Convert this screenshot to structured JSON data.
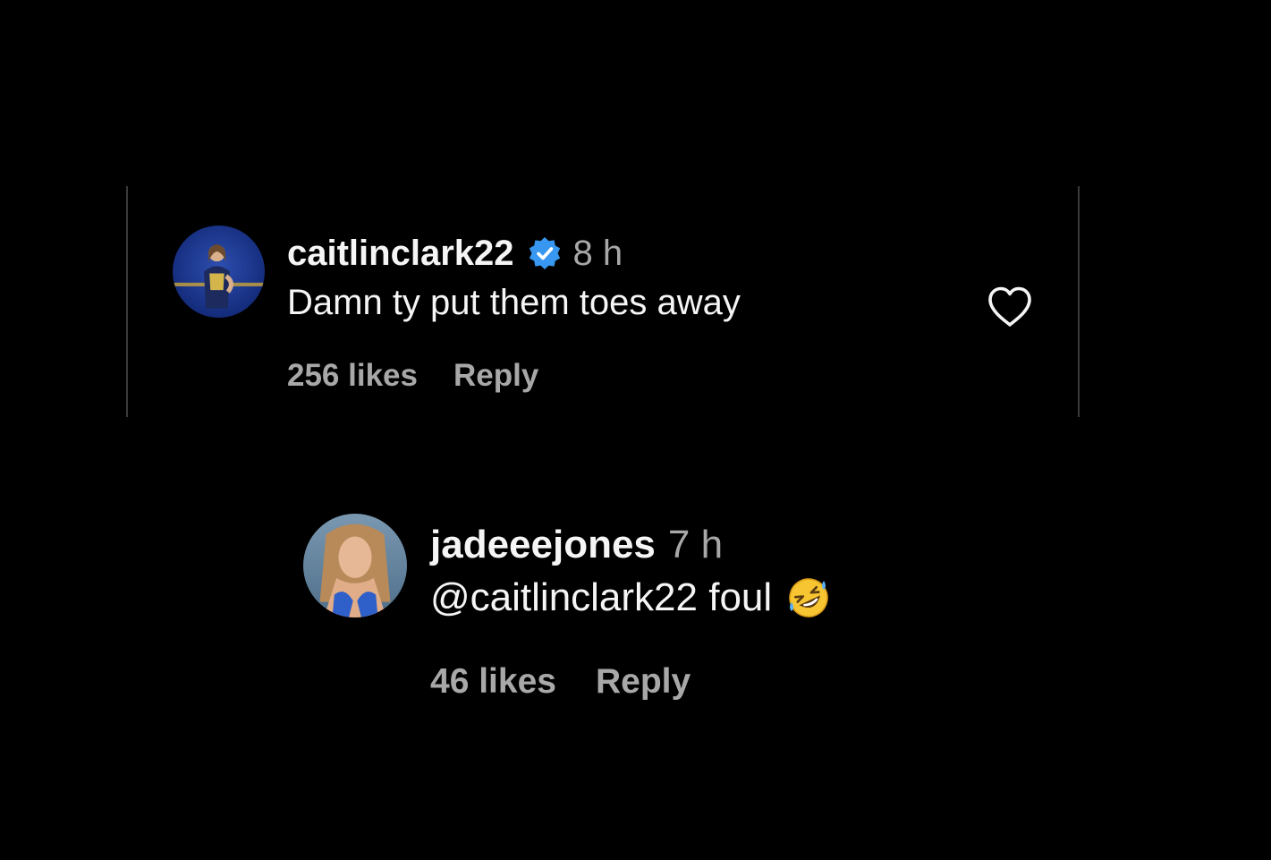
{
  "comments": [
    {
      "username": "caitlinclark22",
      "verified": true,
      "time": "8 h",
      "text": "Damn ty put them toes away",
      "likes": "256 likes",
      "reply_label": "Reply",
      "like_icon": "heart-outline-icon"
    },
    {
      "username": "jadeeejones",
      "time": "7 h",
      "text": "@caitlinclark22 foul",
      "emoji": "rolling-on-floor-laughing",
      "likes": "46 likes",
      "reply_label": "Reply"
    }
  ],
  "colors": {
    "background": "#000000",
    "text_primary": "#f5f5f5",
    "text_secondary": "#a8a8a8",
    "verified_badge": "#3897f0",
    "divider": "#3a3a3a"
  }
}
